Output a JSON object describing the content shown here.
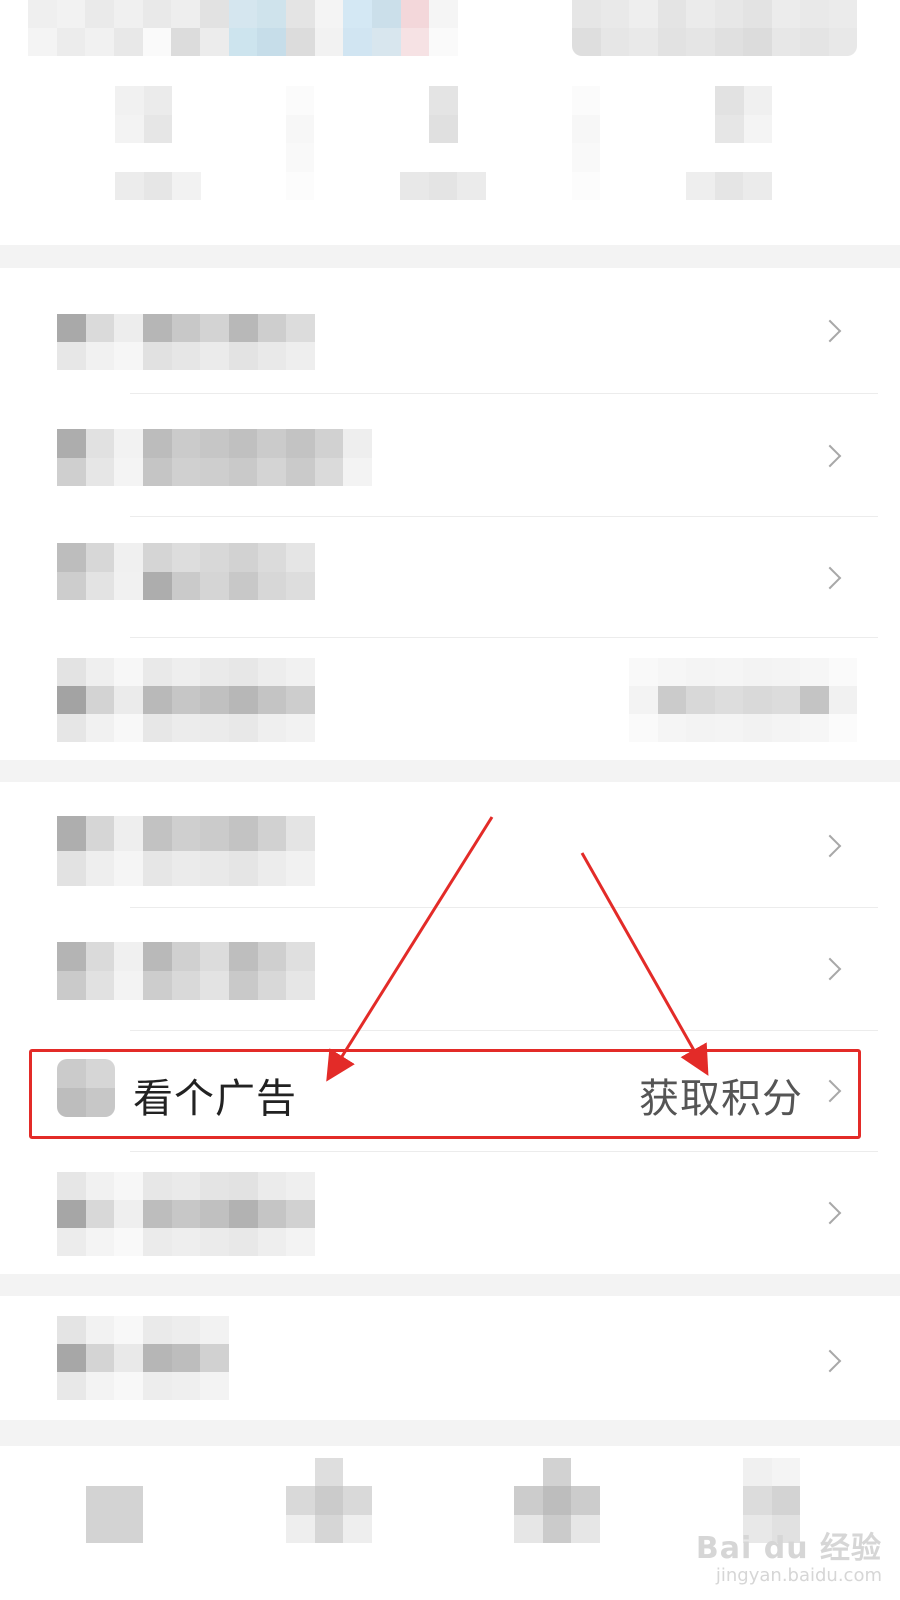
{
  "ad_row": {
    "label": "看个广告",
    "value": "获取积分"
  },
  "watermark": {
    "main": "Bai du 经验",
    "sub": "jingyan.baidu.com"
  },
  "colors": {
    "highlight": "#e32b28",
    "arrow": "#e32b28",
    "background": "#ffffff",
    "section_gap": "#f3f3f3",
    "chevron": "#a8a8a8"
  },
  "icons": {
    "row_chevron": "chevron-right-icon"
  }
}
